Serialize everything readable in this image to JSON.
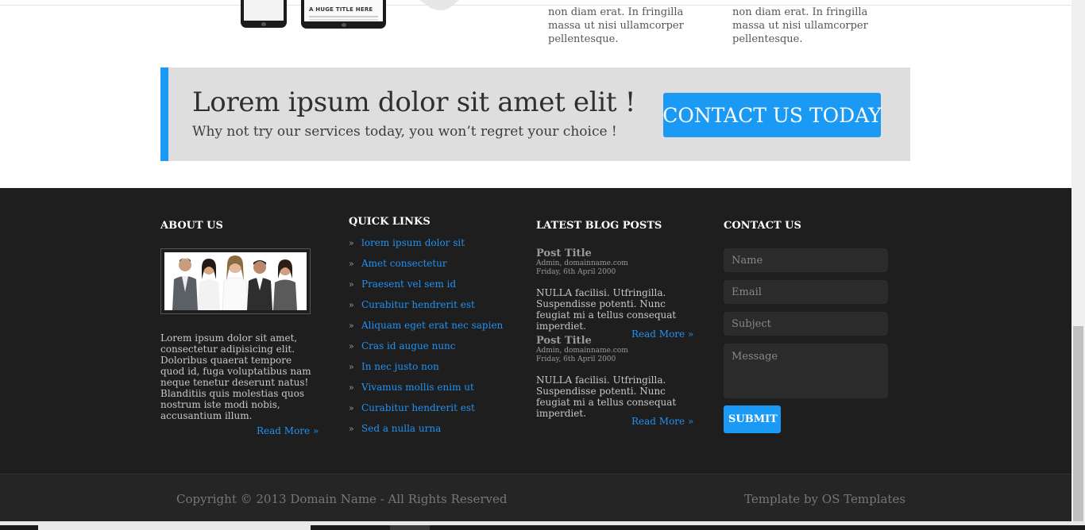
{
  "top_section": {
    "phone_screen_text": "A HUGE TITLE HERE",
    "columns": [
      {
        "text": "non diam erat. In fringilla massa ut nisi ullamcorper pellentesque."
      },
      {
        "text": "non diam erat. In fringilla massa ut nisi ullamcorper pellentesque."
      }
    ]
  },
  "banner": {
    "title": "Lorem ipsum dolor sit amet elit !",
    "subtitle": "Why not try our services today, you won’t regret your choice !",
    "cta_label": "CONTACT US TODAY"
  },
  "footer": {
    "about": {
      "heading": "ABOUT US",
      "text": "Lorem ipsum dolor sit amet, consectetur adipisicing elit. Doloribus quaerat tempore quod id, fuga voluptatibus nam neque tenetur deserunt natus! Blanditiis quis molestias quos nostrum iste modi nobis, accusantium illum.",
      "read_more": "Read More »"
    },
    "quick_links": {
      "heading": "QUICK LINKS",
      "bullet": "»",
      "items": [
        "lorem ipsum dolor sit",
        "Amet consectetur",
        "Praesent vel sem id",
        "Curabitur hendrerit est",
        "Aliquam eget erat nec sapien",
        "Cras id augue nunc",
        "In nec justo non",
        "Vivamus mollis enim ut",
        "Curabitur hendrerit est",
        "Sed a nulla urna"
      ]
    },
    "blog": {
      "heading": "LATEST BLOG POSTS",
      "posts": [
        {
          "title": "Post Title",
          "author": "Admin, domainname.com",
          "date": "Friday, 6th April 2000",
          "excerpt": "NULLA facilisi. Utfringilla. Suspendisse potenti. Nunc feugiat mi a tellus consequat imperdiet.",
          "read_more": "Read More »"
        },
        {
          "title": "Post Title",
          "author": "Admin, domainname.com",
          "date": "Friday, 6th April 2000",
          "excerpt": "NULLA facilisi. Utfringilla. Suspendisse potenti. Nunc feugiat mi a tellus consequat imperdiet.",
          "read_more": "Read More »"
        }
      ]
    },
    "contact": {
      "heading": "CONTACT US",
      "name_placeholder": "Name",
      "email_placeholder": "Email",
      "subject_placeholder": "Subject",
      "message_placeholder": "Message",
      "submit_label": "SUBMIT"
    }
  },
  "bottom_bar": {
    "copyright": "Copyright © 2013 Domain Name - All Rights Reserved",
    "template_credit": "Template by OS Templates"
  },
  "colors": {
    "accent": "#1a99f5",
    "link": "#2291f2",
    "footer_bg": "#1e1e1e",
    "banner_bg": "#dedede"
  }
}
